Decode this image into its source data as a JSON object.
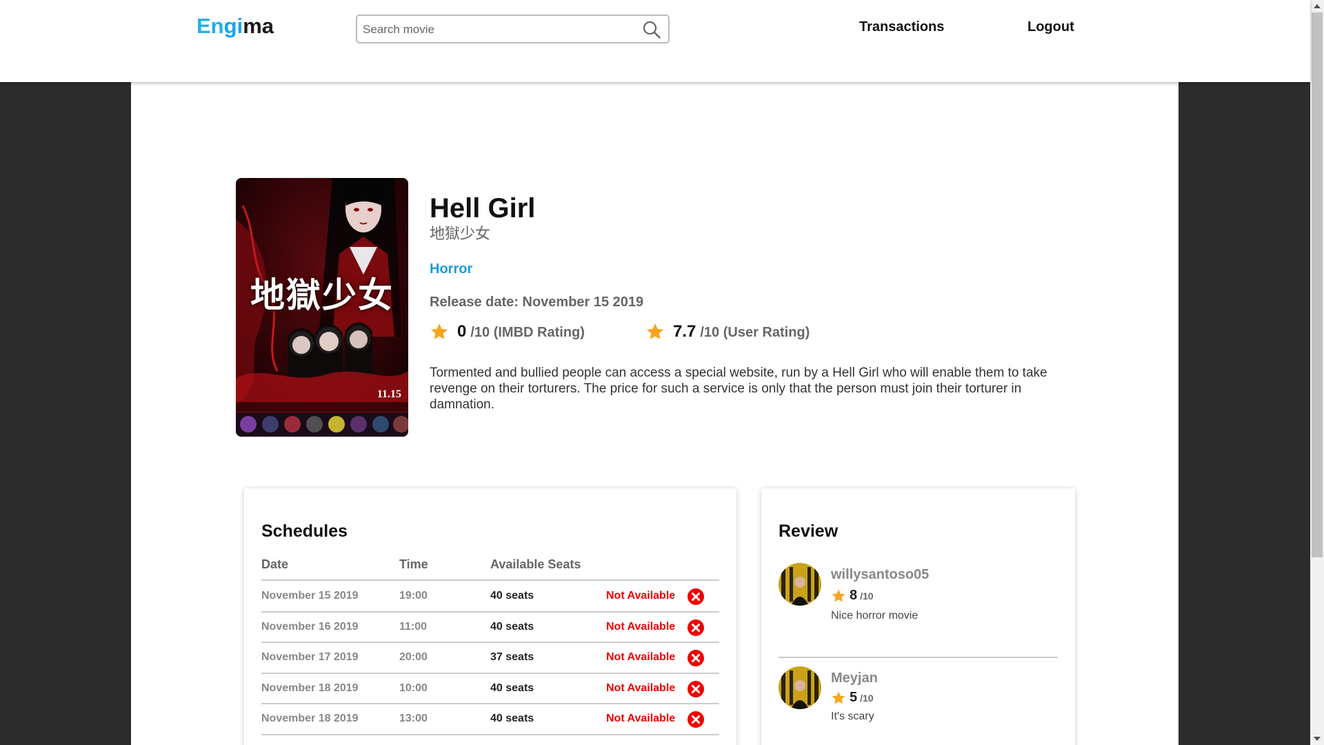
{
  "header": {
    "logo_part1": "En",
    "logo_part2": "gi",
    "logo_part3": "ma",
    "search_placeholder": "Search movie",
    "nav_transactions": "Transactions",
    "nav_logout": "Logout"
  },
  "movie": {
    "title": "Hell Girl",
    "original_title": "地獄少女",
    "genre": "Horror",
    "release": "Release date: November 15 2019",
    "imdb_rating": "0",
    "imdb_suffix": "/10 (IMBD Rating)",
    "user_rating": "7.7",
    "user_suffix": "/10 (User Rating)",
    "description": "Tormented and bullied people can access a special website, run by a Hell Girl who will enable them to take revenge on their torturers. The price for such a service is only that the person must join their torturer in damnation.",
    "poster": {
      "title_text": "地獄少女",
      "date_text": "11.15"
    }
  },
  "schedules": {
    "title": "Schedules",
    "headers": {
      "date": "Date",
      "time": "Time",
      "seats": "Available Seats"
    },
    "rows": [
      {
        "date": "November 15 2019",
        "time": "19:00",
        "seats": "40 seats",
        "status": "Not Available"
      },
      {
        "date": "November 16 2019",
        "time": "11:00",
        "seats": "40 seats",
        "status": "Not Available"
      },
      {
        "date": "November 17 2019",
        "time": "20:00",
        "seats": "37 seats",
        "status": "Not Available"
      },
      {
        "date": "November 18 2019",
        "time": "10:00",
        "seats": "40 seats",
        "status": "Not Available"
      },
      {
        "date": "November 18 2019",
        "time": "13:00",
        "seats": "40 seats",
        "status": "Not Available"
      }
    ]
  },
  "review": {
    "title": "Review",
    "items": [
      {
        "user": "willysantoso05",
        "rating": "8",
        "suffix": "/10",
        "text": "Nice horror movie"
      },
      {
        "user": "Meyjan",
        "rating": "5",
        "suffix": "/10",
        "text": "It's scary"
      }
    ]
  },
  "colors": {
    "accent": "#1a9ed8",
    "star": "#f7a51c",
    "unavailable": "#e00000",
    "background": "#2c2c2c"
  },
  "icons": [
    "search-icon",
    "star-icon",
    "close-circle-icon"
  ]
}
